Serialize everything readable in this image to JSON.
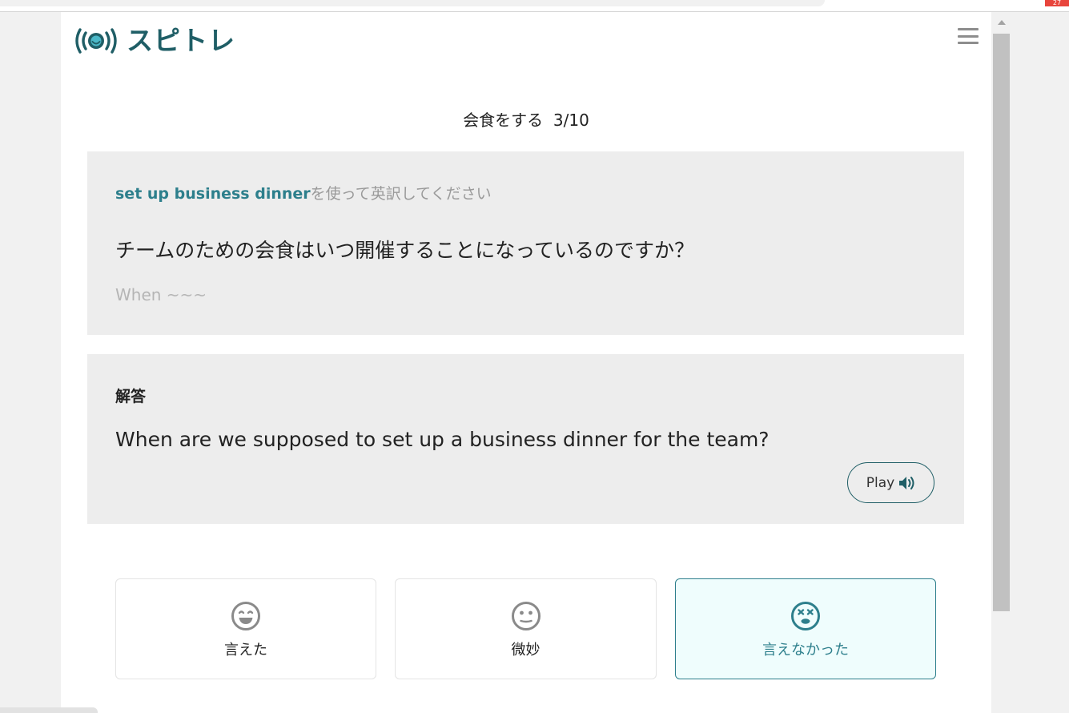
{
  "app": {
    "name": "スピトレ",
    "brand_color": "#1f5e66",
    "accent_color": "#2d7f8c"
  },
  "browser": {
    "notification_count": "27"
  },
  "quiz": {
    "title": "会食をする",
    "progress": "3/10"
  },
  "question_card": {
    "phrase": "set up business dinner",
    "instruction_suffix": "を使って英訳してください",
    "question": "チームのための会食はいつ開催することになっているのですか？",
    "hint": "When ~~~"
  },
  "answer_card": {
    "label": "解答",
    "answer": "When are we supposed to set up a business dinner for the team?",
    "play_label": "Play",
    "play_icon": "volume-icon"
  },
  "rating": [
    {
      "label": "言えた",
      "icon": "grin-face-icon",
      "selected": false
    },
    {
      "label": "微妙",
      "icon": "neutral-face-icon",
      "selected": false
    },
    {
      "label": "言えなかった",
      "icon": "dizzy-face-icon",
      "selected": true
    }
  ]
}
